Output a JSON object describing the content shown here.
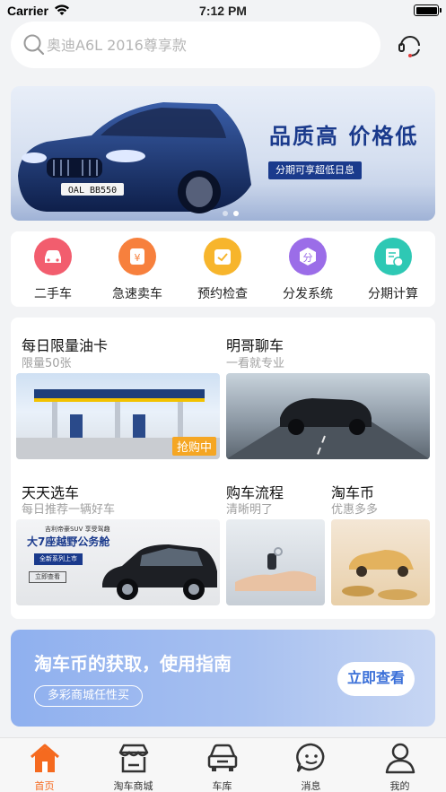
{
  "status_bar": {
    "carrier": "Carrier",
    "time": "7:12 PM"
  },
  "search": {
    "placeholder": "奥迪A6L 2016尊享款"
  },
  "banner": {
    "headline": "品质高  价格低",
    "subtag": "分期可享超低日息",
    "plate": "OAL BB550"
  },
  "quick_nav": [
    {
      "label": "二手车",
      "icon": "car-icon",
      "color": "#f25d6e"
    },
    {
      "label": "急速卖车",
      "icon": "yuan-tag-icon",
      "color": "#f7803d"
    },
    {
      "label": "预约检查",
      "icon": "calendar-check-icon",
      "color": "#f7b52c"
    },
    {
      "label": "分发系统",
      "icon": "distribution-icon",
      "color": "#9b6de8"
    },
    {
      "label": "分期计算",
      "icon": "installment-icon",
      "color": "#2ec8b4"
    }
  ],
  "features": {
    "fuel_card": {
      "title": "每日限量油卡",
      "subtitle": "限量50张",
      "badge": "抢购中"
    },
    "chat": {
      "title": "明哥聊车",
      "subtitle": "一看就专业"
    },
    "daily_pick": {
      "title": "天天选车",
      "subtitle": "每日推荐一辆好车",
      "ad_brand": "吉利帝豪SUV 享受驾趣",
      "ad_headline": "大7座越野公务舱",
      "ad_tag": "全新系列上市",
      "ad_button": "立即查看"
    },
    "process": {
      "title": "购车流程",
      "subtitle": "清晰明了"
    },
    "coins": {
      "title": "淘车币",
      "subtitle": "优惠多多"
    }
  },
  "promo": {
    "title": "淘车币的获取，使用指南",
    "subtitle": "多彩商城任性买",
    "button": "立即查看"
  },
  "tab_bar": [
    {
      "label": "首页",
      "icon": "home-icon",
      "active": true
    },
    {
      "label": "淘车商城",
      "icon": "store-icon",
      "active": false
    },
    {
      "label": "车库",
      "icon": "garage-icon",
      "active": false
    },
    {
      "label": "消息",
      "icon": "message-icon",
      "active": false
    },
    {
      "label": "我的",
      "icon": "user-icon",
      "active": false
    }
  ],
  "colors": {
    "accent": "#f56a1f",
    "promo_button_text": "#3a6fd8",
    "banner_text": "#1a3a8c"
  }
}
